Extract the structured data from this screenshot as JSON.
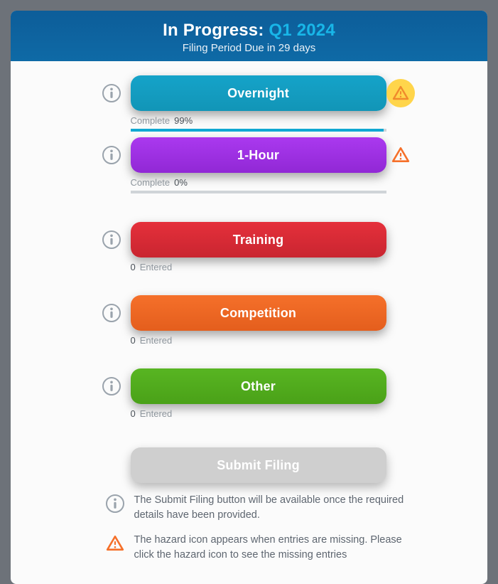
{
  "header": {
    "prefix": "In Progress: ",
    "period": "Q1 2024",
    "subtitle": "Filing Period Due in 29 days"
  },
  "rows": {
    "overnight": {
      "label": "Overnight",
      "complete_label": "Complete",
      "complete_value": "99%",
      "progress_style": "width:99%"
    },
    "one_hour": {
      "label": "1-Hour",
      "complete_label": "Complete",
      "complete_value": "0%",
      "progress_style": "width:0%"
    },
    "training": {
      "label": "Training",
      "count": "0",
      "count_label": "Entered"
    },
    "competition": {
      "label": "Competition",
      "count": "0",
      "count_label": "Entered"
    },
    "other": {
      "label": "Other",
      "count": "0",
      "count_label": "Entered"
    }
  },
  "submit": {
    "label": "Submit Filing"
  },
  "notes": {
    "submit_info": "The Submit Filing button will be available once the required details have been provided.",
    "hazard_info": "The hazard icon appears when entries are missing. Please click the hazard icon to see the missing entries"
  }
}
